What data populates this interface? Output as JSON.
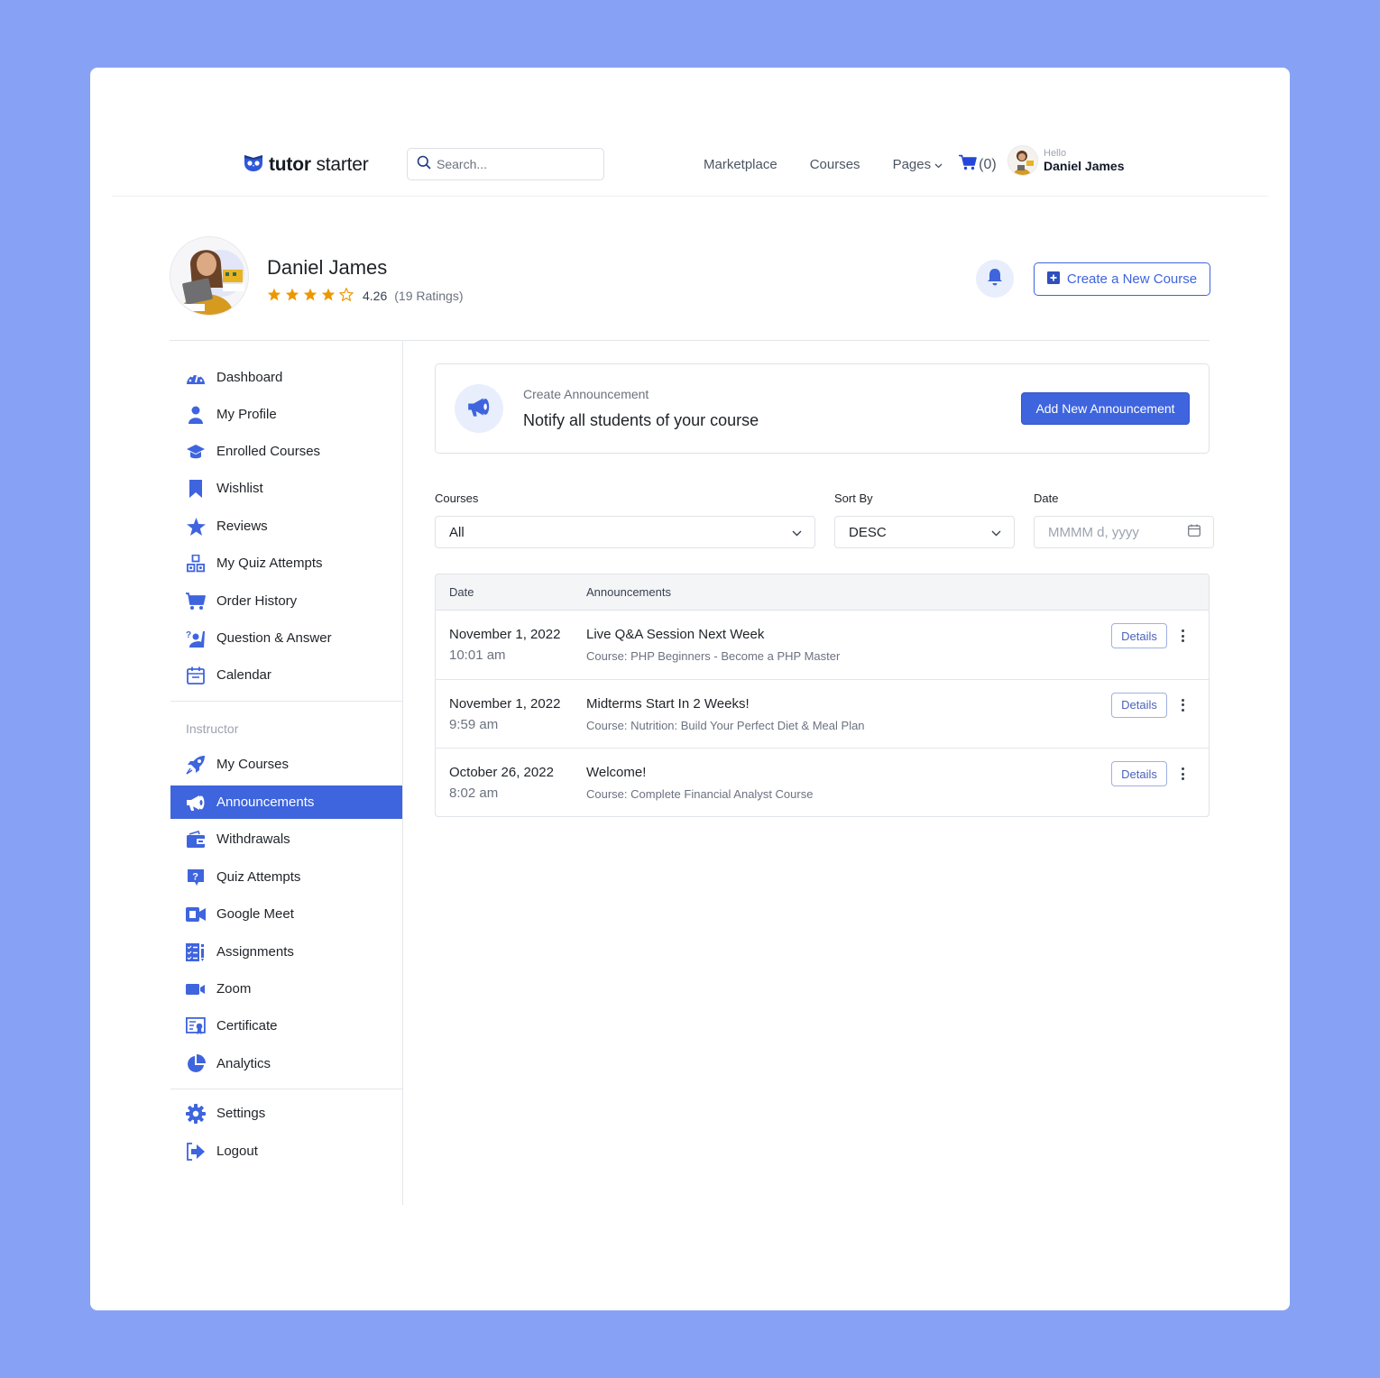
{
  "colors": {
    "background": "#87a2f5",
    "accent": "#3e64de",
    "star": "#ed9700"
  },
  "header": {
    "logo": {
      "bold": "tutor",
      "light": " starter",
      "icon": "owl-logo-icon"
    },
    "search": {
      "placeholder": "Search...",
      "value": "",
      "icon": "search-icon"
    },
    "nav": [
      {
        "label": "Marketplace"
      },
      {
        "label": "Courses"
      },
      {
        "label": "Pages",
        "icon": "chevron-down-icon"
      }
    ],
    "cart": {
      "icon": "cart-icon",
      "count_label": "(0)"
    },
    "user": {
      "greeting": "Hello",
      "name": "Daniel James"
    }
  },
  "profile": {
    "name": "Daniel James",
    "rating": {
      "value": "4.26",
      "stars_filled": 4,
      "stars_total": 5,
      "count_label": "(19 Ratings)"
    },
    "bell_icon": "bell-icon",
    "create_course_label": "Create a New Course"
  },
  "sidebar": {
    "items": [
      {
        "label": "Dashboard",
        "icon": "dashboard-gauge-icon"
      },
      {
        "label": "My Profile",
        "icon": "user-icon"
      },
      {
        "label": "Enrolled Courses",
        "icon": "graduation-cap-icon"
      },
      {
        "label": "Wishlist",
        "icon": "bookmark-icon"
      },
      {
        "label": "Reviews",
        "icon": "star-icon"
      },
      {
        "label": "My Quiz Attempts",
        "icon": "quiz-blocks-icon"
      },
      {
        "label": "Order History",
        "icon": "cart-icon"
      },
      {
        "label": "Question & Answer",
        "icon": "question-answer-icon"
      },
      {
        "label": "Calendar",
        "icon": "calendar-icon"
      }
    ],
    "section_label": "Instructor",
    "instructor_items": [
      {
        "label": "My Courses",
        "icon": "rocket-icon"
      },
      {
        "label": "Announcements",
        "icon": "megaphone-icon",
        "active": true
      },
      {
        "label": "Withdrawals",
        "icon": "wallet-icon"
      },
      {
        "label": "Quiz Attempts",
        "icon": "quiz-question-icon"
      },
      {
        "label": "Google Meet",
        "icon": "video-meet-icon"
      },
      {
        "label": "Assignments",
        "icon": "assignment-list-icon"
      },
      {
        "label": "Zoom",
        "icon": "zoom-camera-icon"
      },
      {
        "label": "Certificate",
        "icon": "certificate-icon"
      },
      {
        "label": "Analytics",
        "icon": "pie-chart-icon"
      }
    ],
    "bottom_items": [
      {
        "label": "Settings",
        "icon": "gear-icon"
      },
      {
        "label": "Logout",
        "icon": "logout-icon"
      }
    ]
  },
  "announcement_box": {
    "subtitle": "Create Announcement",
    "title": "Notify all students of your course",
    "button_label": "Add New Announcement"
  },
  "filters": {
    "courses": {
      "label": "Courses",
      "value": "All"
    },
    "sort_by": {
      "label": "Sort By",
      "value": "DESC"
    },
    "date": {
      "label": "Date",
      "placeholder": "MMMM d, yyyy"
    }
  },
  "table": {
    "headers": [
      "Date",
      "Announcements"
    ],
    "rows": [
      {
        "date": "November 1, 2022",
        "time": "10:01 am",
        "title": "Live Q&A Session Next Week",
        "course": "Course: PHP Beginners - Become a PHP Master",
        "button": "Details"
      },
      {
        "date": "November 1, 2022",
        "time": "9:59 am",
        "title": "Midterms Start In 2 Weeks!",
        "course": "Course: Nutrition: Build Your Perfect Diet & Meal Plan",
        "button": "Details"
      },
      {
        "date": "October 26, 2022",
        "time": "8:02 am",
        "title": "Welcome!",
        "course": "Course: Complete Financial Analyst Course",
        "button": "Details"
      }
    ]
  }
}
